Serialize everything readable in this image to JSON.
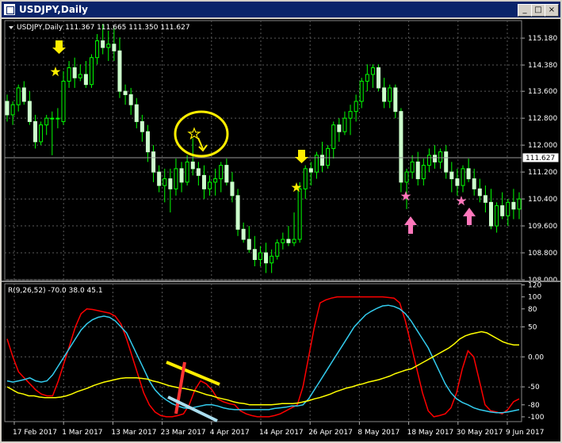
{
  "window": {
    "title": "USDJPY,Daily",
    "minimize": "_",
    "maximize": "□",
    "close": "×"
  },
  "price_header": "USDJPY,Daily  111.367 111.665 111.350 111.627",
  "indicator_header": "R(9,26,52) -70.0 38.0 45.1",
  "current_price_label": "111.627",
  "colors": {
    "background": "#000000",
    "grid": "#5a5a5a",
    "candle": "#ccffcc",
    "wick": "#00ff00",
    "red": "#ff0000",
    "cyan": "#33ccee",
    "yellow": "#ffff00",
    "annotation_yellow": "#ffee00",
    "annotation_pink": "#ff77bb"
  },
  "chart_data": [
    {
      "type": "candlestick",
      "x_ticks": [
        "17 Feb 2017",
        "1 Mar 2017",
        "13 Mar 2017",
        "23 Mar 2017",
        "4 Apr 2017",
        "14 Apr 2017",
        "26 Apr 2017",
        "8 May 2017",
        "18 May 2017",
        "30 May 2017",
        "9 Jun 2017"
      ],
      "y_ticks": [
        "115.180",
        "114.380",
        "113.600",
        "112.800",
        "112.000",
        "111.200",
        "110.400",
        "109.600",
        "108.800",
        "108.000"
      ],
      "ylim": [
        108.0,
        115.7
      ],
      "current_price": 111.627,
      "candles": [
        [
          113.3,
          113.5,
          112.7,
          112.9
        ],
        [
          112.9,
          113.3,
          112.6,
          113.2
        ],
        [
          113.2,
          113.8,
          113.0,
          113.7
        ],
        [
          113.7,
          113.9,
          113.2,
          113.3
        ],
        [
          113.3,
          113.6,
          112.6,
          112.7
        ],
        [
          112.7,
          112.9,
          111.9,
          112.1
        ],
        [
          112.1,
          112.7,
          112.0,
          112.6
        ],
        [
          112.6,
          112.9,
          112.3,
          112.8
        ],
        [
          112.8,
          113.0,
          111.7,
          112.8
        ],
        [
          112.8,
          113.1,
          112.5,
          112.8
        ],
        [
          112.7,
          114.2,
          112.6,
          113.9
        ],
        [
          113.9,
          114.5,
          113.7,
          114.3
        ],
        [
          114.3,
          114.6,
          113.7,
          114.0
        ],
        [
          114.0,
          114.4,
          113.9,
          114.1
        ],
        [
          114.1,
          114.5,
          113.7,
          113.8
        ],
        [
          113.8,
          114.7,
          113.7,
          114.6
        ],
        [
          114.6,
          115.3,
          114.4,
          115.1
        ],
        [
          115.1,
          115.6,
          114.7,
          114.9
        ],
        [
          114.9,
          115.4,
          114.5,
          115.0
        ],
        [
          115.0,
          115.5,
          114.5,
          114.8
        ],
        [
          114.8,
          115.2,
          113.4,
          113.6
        ],
        [
          113.6,
          113.8,
          113.2,
          113.5
        ],
        [
          113.5,
          113.7,
          112.9,
          113.2
        ],
        [
          113.2,
          113.4,
          112.5,
          112.7
        ],
        [
          112.7,
          112.9,
          112.1,
          112.4
        ],
        [
          112.4,
          112.6,
          111.5,
          111.8
        ],
        [
          111.8,
          112.0,
          110.9,
          111.2
        ],
        [
          111.2,
          111.4,
          110.6,
          110.8
        ],
        [
          110.8,
          111.3,
          110.3,
          111.0
        ],
        [
          111.0,
          111.3,
          110.0,
          110.7
        ],
        [
          110.7,
          111.6,
          110.5,
          111.3
        ],
        [
          111.3,
          111.5,
          110.6,
          110.9
        ],
        [
          110.9,
          111.7,
          110.8,
          111.5
        ],
        [
          111.5,
          112.2,
          111.1,
          111.3
        ],
        [
          111.3,
          111.5,
          110.8,
          111.1
        ],
        [
          111.1,
          111.4,
          110.4,
          110.7
        ],
        [
          110.7,
          111.1,
          110.5,
          110.9
        ],
        [
          110.9,
          111.3,
          110.5,
          111.0
        ],
        [
          111.0,
          111.5,
          110.6,
          111.4
        ],
        [
          111.4,
          111.6,
          110.8,
          110.9
        ],
        [
          110.9,
          111.2,
          110.3,
          110.5
        ],
        [
          110.5,
          110.7,
          109.3,
          109.5
        ],
        [
          109.5,
          109.7,
          109.1,
          109.2
        ],
        [
          109.2,
          109.6,
          108.8,
          108.9
        ],
        [
          108.9,
          109.3,
          108.4,
          108.6
        ],
        [
          108.6,
          109.0,
          108.4,
          108.8
        ],
        [
          108.8,
          109.1,
          108.2,
          108.5
        ],
        [
          108.5,
          108.9,
          108.2,
          108.7
        ],
        [
          108.7,
          109.2,
          108.6,
          109.1
        ],
        [
          109.1,
          109.4,
          108.9,
          109.2
        ],
        [
          109.2,
          109.6,
          109.0,
          109.1
        ],
        [
          109.1,
          110.0,
          109.0,
          109.2
        ],
        [
          109.2,
          110.9,
          109.1,
          110.7
        ],
        [
          110.7,
          111.4,
          110.4,
          111.3
        ],
        [
          111.3,
          111.5,
          110.8,
          111.2
        ],
        [
          111.2,
          111.8,
          111.0,
          111.7
        ],
        [
          111.7,
          112.1,
          111.2,
          111.4
        ],
        [
          111.4,
          112.0,
          111.3,
          111.9
        ],
        [
          111.9,
          112.7,
          111.6,
          112.6
        ],
        [
          112.6,
          112.8,
          112.1,
          112.4
        ],
        [
          112.4,
          113.0,
          112.3,
          112.8
        ],
        [
          112.8,
          113.2,
          112.3,
          113.0
        ],
        [
          113.0,
          113.5,
          112.7,
          113.3
        ],
        [
          113.3,
          114.0,
          113.1,
          113.9
        ],
        [
          113.9,
          114.4,
          113.6,
          114.1
        ],
        [
          114.1,
          114.4,
          113.7,
          114.3
        ],
        [
          114.3,
          114.4,
          113.6,
          113.7
        ],
        [
          113.7,
          114.0,
          113.1,
          113.3
        ],
        [
          113.3,
          113.8,
          113.1,
          113.7
        ],
        [
          113.7,
          113.8,
          112.8,
          113.0
        ],
        [
          113.0,
          113.1,
          110.6,
          110.9
        ],
        [
          110.9,
          111.3,
          110.1,
          111.2
        ],
        [
          111.2,
          111.7,
          111.0,
          111.5
        ],
        [
          111.5,
          111.8,
          110.8,
          111.0
        ],
        [
          111.0,
          111.6,
          110.8,
          111.4
        ],
        [
          111.4,
          111.9,
          111.2,
          111.7
        ],
        [
          111.7,
          112.0,
          111.3,
          111.5
        ],
        [
          111.5,
          111.9,
          111.3,
          111.8
        ],
        [
          111.8,
          112.0,
          111.0,
          111.2
        ],
        [
          111.2,
          111.5,
          110.6,
          111.0
        ],
        [
          111.0,
          111.3,
          110.5,
          110.8
        ],
        [
          110.8,
          111.4,
          110.6,
          111.3
        ],
        [
          111.3,
          111.6,
          110.9,
          111.0
        ],
        [
          111.0,
          111.3,
          110.5,
          110.7
        ],
        [
          110.7,
          111.0,
          110.3,
          110.5
        ],
        [
          110.5,
          110.8,
          110.0,
          110.3
        ],
        [
          110.3,
          110.7,
          109.5,
          109.6
        ],
        [
          109.6,
          110.3,
          109.4,
          110.2
        ],
        [
          110.2,
          110.6,
          109.8,
          109.9
        ],
        [
          109.9,
          110.4,
          109.6,
          110.3
        ],
        [
          110.3,
          110.7,
          109.8,
          110.1
        ],
        [
          110.1,
          110.6,
          109.8,
          110.4
        ]
      ]
    },
    {
      "type": "line",
      "y_ticks": [
        "120",
        "100",
        "80",
        "50",
        "0.00",
        "-50",
        "-80",
        "-100"
      ],
      "ylim": [
        -108,
        122
      ],
      "series": [
        {
          "values": [
            30,
            0,
            -25,
            -35,
            -45,
            -55,
            -62,
            -65,
            -65,
            -40,
            -10,
            20,
            50,
            72,
            80,
            79,
            77,
            75,
            73,
            68,
            55,
            30,
            0,
            -30,
            -60,
            -80,
            -92,
            -98,
            -100,
            -100,
            -98,
            -95,
            -80,
            -55,
            -40,
            -45,
            -55,
            -70,
            -75,
            -78,
            -80,
            -90,
            -95,
            -98,
            -100,
            -100,
            -100,
            -98,
            -95,
            -90,
            -85,
            -80,
            -50,
            0,
            50,
            90,
            95,
            98,
            100,
            100,
            100,
            100,
            100,
            100,
            100,
            100,
            100,
            99,
            98,
            90,
            60,
            20,
            -20,
            -60,
            -90,
            -100,
            -98,
            -95,
            -85,
            -60,
            -20,
            10,
            0,
            -40,
            -80,
            -90,
            -92,
            -95,
            -88,
            -75,
            -70
          ]
        },
        {
          "values": [
            -40,
            -42,
            -40,
            -38,
            -35,
            -40,
            -42,
            -40,
            -30,
            -15,
            0,
            15,
            30,
            45,
            55,
            62,
            66,
            68,
            66,
            60,
            50,
            40,
            20,
            0,
            -20,
            -40,
            -55,
            -65,
            -72,
            -78,
            -82,
            -85,
            -86,
            -84,
            -82,
            -80,
            -80,
            -82,
            -85,
            -87,
            -88,
            -88,
            -88,
            -88,
            -88,
            -88,
            -88,
            -86,
            -85,
            -84,
            -82,
            -82,
            -80,
            -70,
            -55,
            -40,
            -25,
            -10,
            5,
            20,
            35,
            50,
            60,
            70,
            76,
            81,
            85,
            86,
            84,
            80,
            72,
            60,
            45,
            30,
            15,
            -5,
            -25,
            -45,
            -60,
            -70,
            -76,
            -80,
            -85,
            -88,
            -90,
            -92,
            -93,
            -93,
            -92,
            -90,
            -88
          ]
        },
        {
          "values": [
            -50,
            -55,
            -60,
            -62,
            -65,
            -65,
            -67,
            -68,
            -68,
            -68,
            -67,
            -65,
            -62,
            -58,
            -55,
            -52,
            -48,
            -45,
            -42,
            -40,
            -38,
            -36,
            -35,
            -35,
            -35,
            -36,
            -37,
            -40,
            -42,
            -45,
            -48,
            -50,
            -52,
            -53,
            -55,
            -57,
            -60,
            -63,
            -65,
            -68,
            -70,
            -72,
            -75,
            -77,
            -78,
            -80,
            -80,
            -80,
            -80,
            -80,
            -79,
            -78,
            -78,
            -78,
            -77,
            -75,
            -73,
            -70,
            -68,
            -65,
            -62,
            -58,
            -55,
            -52,
            -50,
            -47,
            -45,
            -42,
            -40,
            -38,
            -35,
            -32,
            -28,
            -25,
            -22,
            -20,
            -15,
            -10,
            -5,
            0,
            5,
            10,
            15,
            22,
            30,
            35,
            38,
            40,
            42,
            40,
            35,
            30,
            25,
            22,
            20,
            20
          ]
        }
      ]
    }
  ]
}
